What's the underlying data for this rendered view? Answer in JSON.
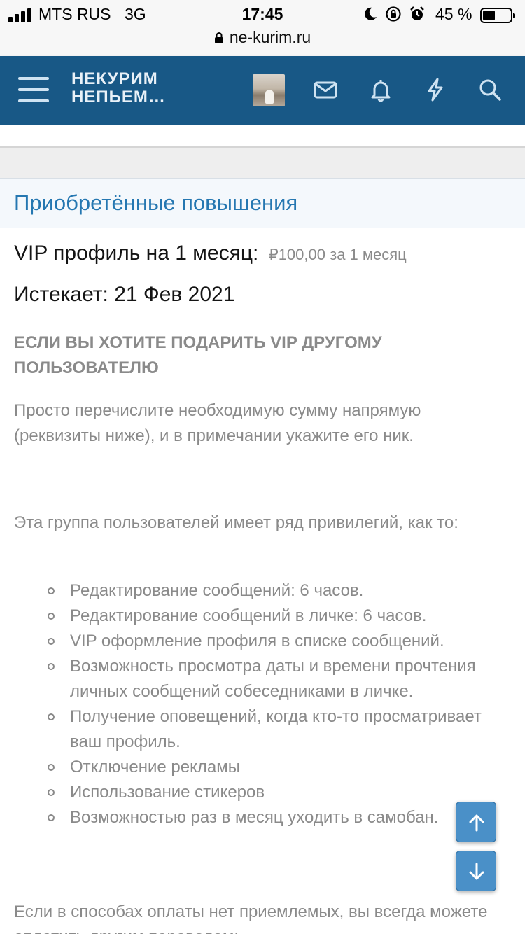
{
  "status_bar": {
    "carrier": "MTS RUS",
    "network": "3G",
    "time": "17:45",
    "battery": "45 %",
    "battery_level": 0.45
  },
  "browser": {
    "url": "ne-kurim.ru"
  },
  "header": {
    "logo_line1": "НЕКУРИМ",
    "logo_line2": "НЕПЬЕМ…",
    "icons": [
      "menu-icon",
      "avatar",
      "mail-icon",
      "bell-icon",
      "lightning-icon",
      "search-icon"
    ]
  },
  "upgrades": {
    "title": "Приобретённые повышения",
    "vip_label": "VIP профиль на 1 месяц:",
    "vip_price": "₽100,00 за 1 месяц",
    "expires": "Истекает: 21 Фев 2021",
    "gift_heading": "ЕСЛИ ВЫ ХОТИТЕ ПОДАРИТЬ VIP ДРУГОМУ ПОЛЬЗОВАТЕЛЮ",
    "gift_text": "Просто перечислите необходимую сумму напрямую (реквизиты ниже), и в примечании укажите его ник.",
    "privileges_intro": "Эта группа пользователей имеет ряд привилегий, как то:",
    "privileges": [
      "Редактирование сообщений: 6 часов.",
      "Редактирование сообщений в личке: 6 часов.",
      "VIP оформление профиля в списке сообщений.",
      "Возможность просмотра даты и времени прочтения личных сообщений собеседниками в личке.",
      "Получение оповещений, когда кто-то просматривает ваш профиль.",
      "Отключение рекламы",
      "Использование стикеров",
      "Возможностью раз в месяц уходить в самобан."
    ],
    "payment_note": "Если в способах оплаты нет приемлемых, вы всегда можете оплатить другим переводом:"
  },
  "colors": {
    "header_bg": "#185886",
    "title_blue": "#2577b1",
    "muted_text": "#8a8a8a",
    "scroll_button": "#4a90c8"
  }
}
